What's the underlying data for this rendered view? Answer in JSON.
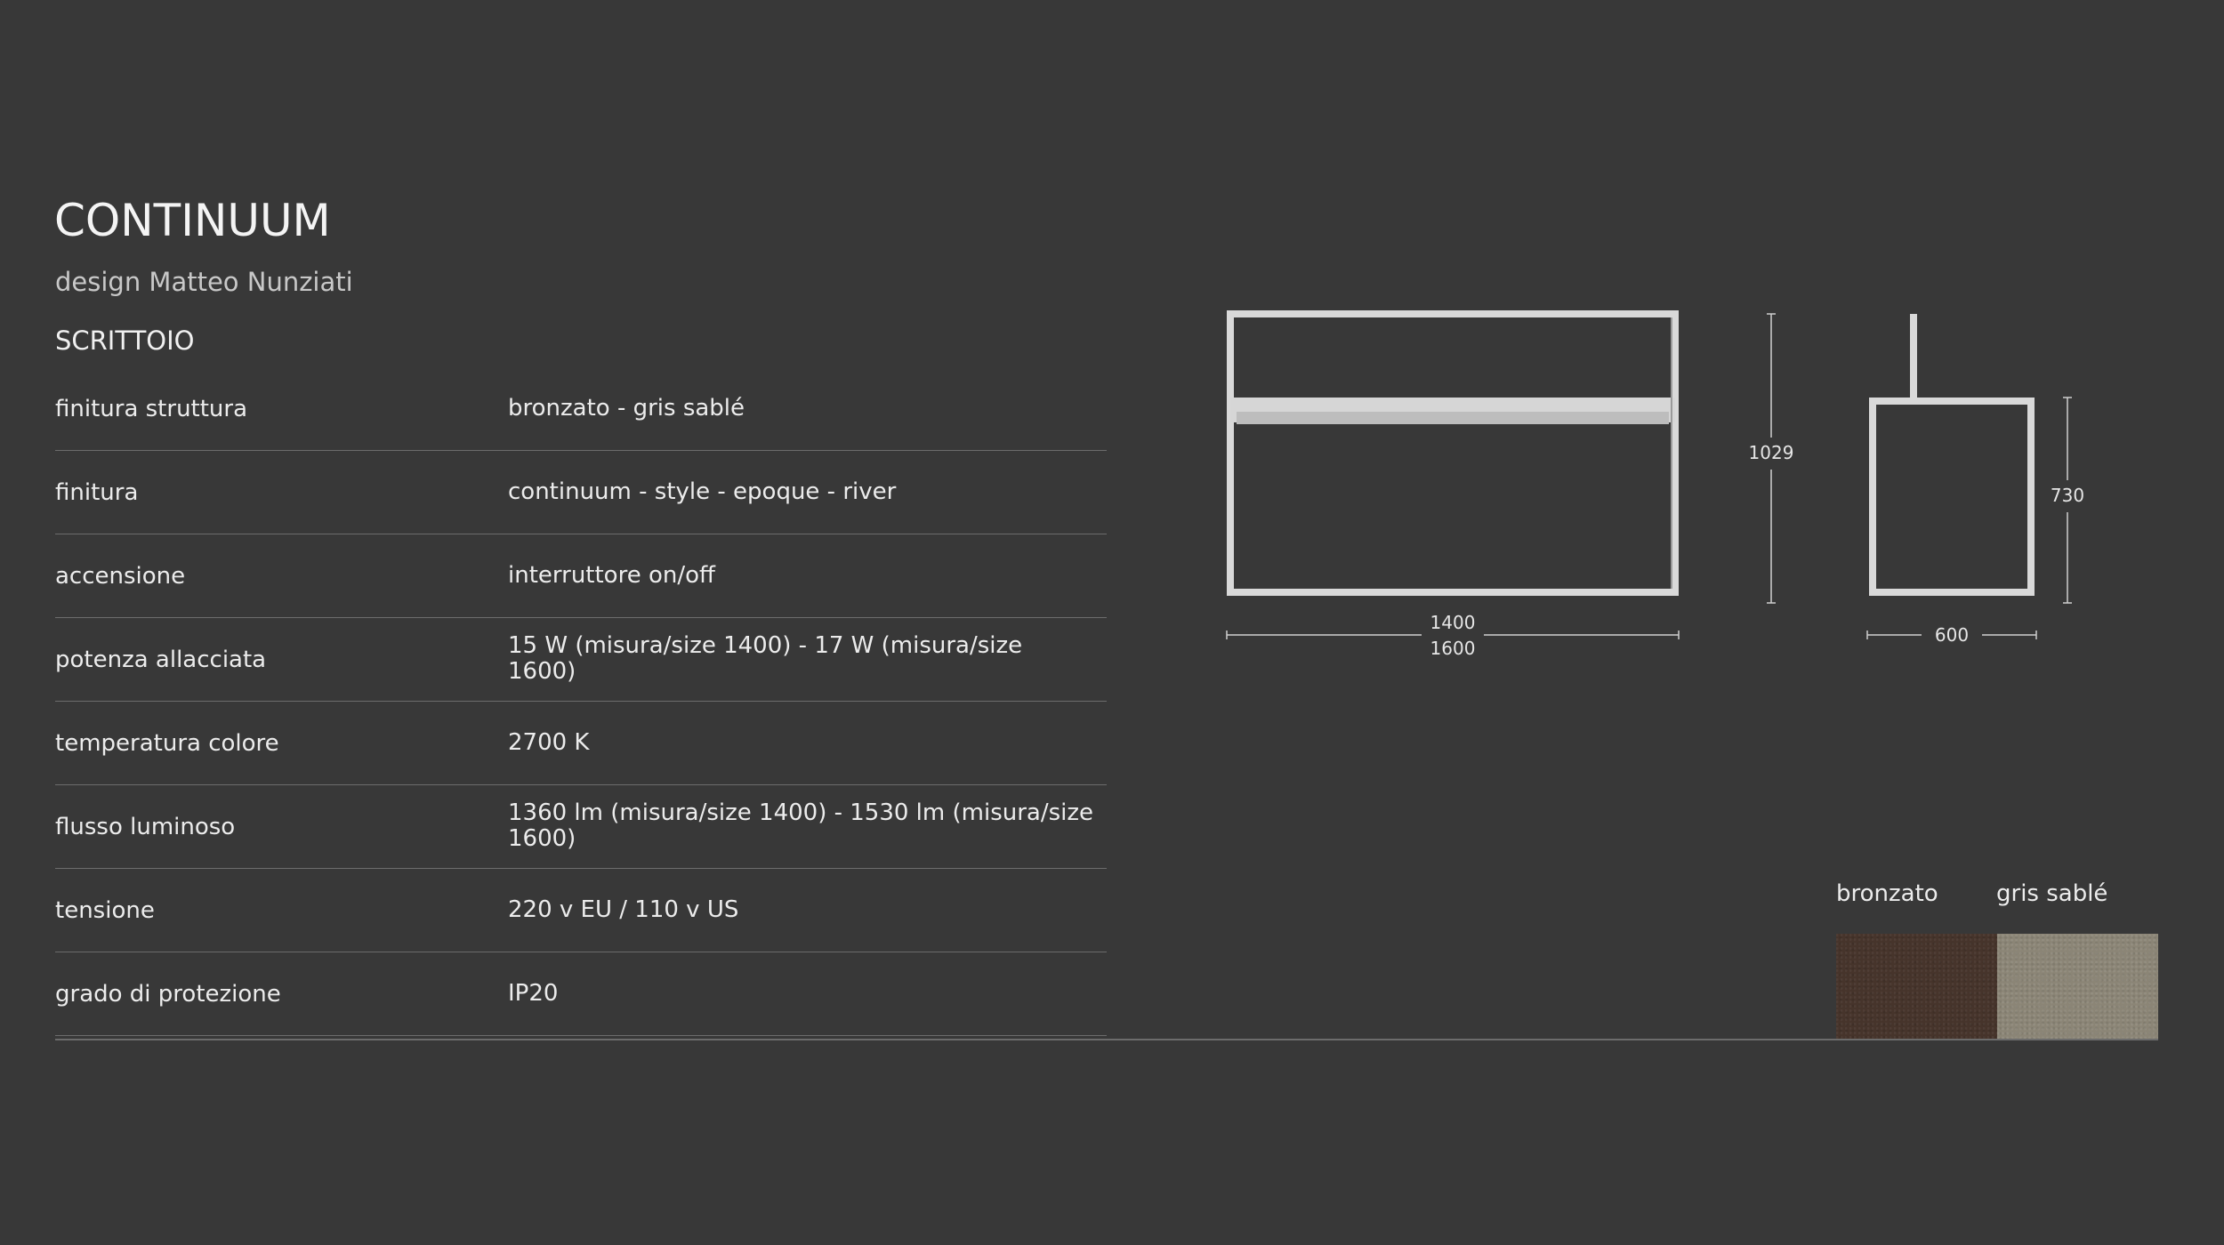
{
  "product": {
    "name": "CONTINUUM",
    "designer": "design Matteo Nunziati",
    "category": "SCRITTOIO"
  },
  "specs": [
    {
      "label": "finitura struttura",
      "value": "bronzato - gris sablé"
    },
    {
      "label": "finitura",
      "value": "continuum - style - epoque - river"
    },
    {
      "label": "accensione",
      "value": "interruttore on/off"
    },
    {
      "label": "potenza allacciata",
      "value": "15 W (misura/size 1400) - 17 W (misura/size 1600)"
    },
    {
      "label": "temperatura colore",
      "value": "2700 K"
    },
    {
      "label": "flusso luminoso",
      "value": "1360 lm (misura/size 1400) - 1530 lm (misura/size 1600)"
    },
    {
      "label": "tensione",
      "value": "220 v EU / 110 v US"
    },
    {
      "label": "grado di protezione",
      "value": "IP20"
    }
  ],
  "dimensions": {
    "width_small": "1400",
    "width_large": "1600",
    "height_total": "1029",
    "height_desk": "730",
    "depth": "600"
  },
  "finishes": [
    {
      "name": "bronzato",
      "color": "#46342b"
    },
    {
      "name": "gris sablé",
      "color": "#8b8576"
    }
  ]
}
